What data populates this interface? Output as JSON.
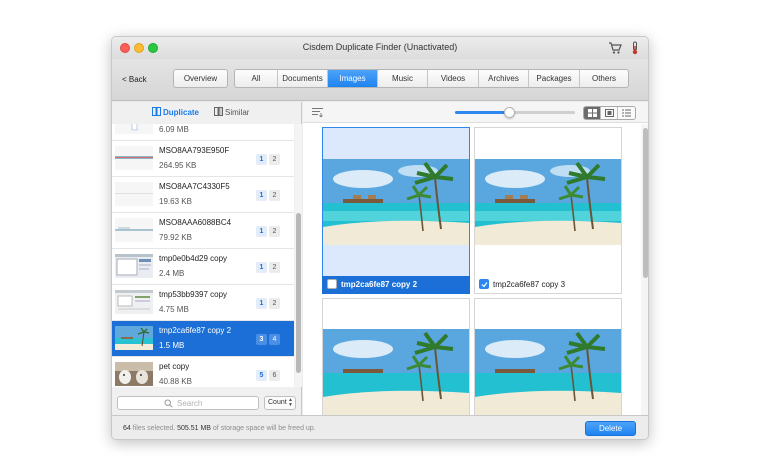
{
  "window": {
    "title": "Cisdem Duplicate Finder (Unactivated)"
  },
  "toolbar": {
    "back_label": "< Back",
    "overview_label": "Overview",
    "tabs": [
      {
        "label": "All",
        "active": false
      },
      {
        "label": "Documents",
        "active": false
      },
      {
        "label": "Images",
        "active": true
      },
      {
        "label": "Music",
        "active": false
      },
      {
        "label": "Videos",
        "active": false
      },
      {
        "label": "Archives",
        "active": false
      },
      {
        "label": "Packages",
        "active": false
      },
      {
        "label": "Others",
        "active": false
      }
    ]
  },
  "sidebar": {
    "mode_duplicate": "Duplicate",
    "mode_similar": "Similar",
    "items": [
      {
        "name": "",
        "size": "6.09 MB",
        "b1": "",
        "b2": "",
        "selected": false,
        "thumb": "doc"
      },
      {
        "name": "MSO8AA793E950F",
        "size": "264.95 KB",
        "b1": "1",
        "b2": "2",
        "selected": false,
        "thumb": "bar"
      },
      {
        "name": "MSO8AA7C4330F5",
        "size": "19.63 KB",
        "b1": "1",
        "b2": "2",
        "selected": false,
        "thumb": "blank"
      },
      {
        "name": "MSO8AAA6088BC4",
        "size": "79.92 KB",
        "b1": "1",
        "b2": "2",
        "selected": false,
        "thumb": "bar"
      },
      {
        "name": "tmp0e0b4d29 copy",
        "size": "2.4 MB",
        "b1": "1",
        "b2": "2",
        "selected": false,
        "thumb": "screen"
      },
      {
        "name": "tmp53bb9397 copy",
        "size": "4.75 MB",
        "b1": "1",
        "b2": "2",
        "selected": false,
        "thumb": "screen"
      },
      {
        "name": "tmp2ca6fe87 copy 2",
        "size": "1.5 MB",
        "b1": "3",
        "b2": "4",
        "selected": true,
        "thumb": "beach"
      },
      {
        "name": "pet copy",
        "size": "40.88 KB",
        "b1": "5",
        "b2": "6",
        "selected": false,
        "thumb": "pet"
      }
    ],
    "search_placeholder": "Search",
    "count_label": "Count"
  },
  "grid": {
    "cards": [
      {
        "label": "tmp2ca6fe87 copy 2",
        "selected": true,
        "checked": false
      },
      {
        "label": "tmp2ca6fe87 copy 3",
        "selected": false,
        "checked": true
      },
      {
        "label": "",
        "selected": false,
        "checked": false
      },
      {
        "label": "",
        "selected": false,
        "checked": false
      }
    ],
    "zoom_level": 0.45
  },
  "status": {
    "count": "64",
    "text1": " files selected. ",
    "size": "505.51 MB",
    "text2": " of storage space will be freed up.",
    "delete_label": "Delete"
  }
}
